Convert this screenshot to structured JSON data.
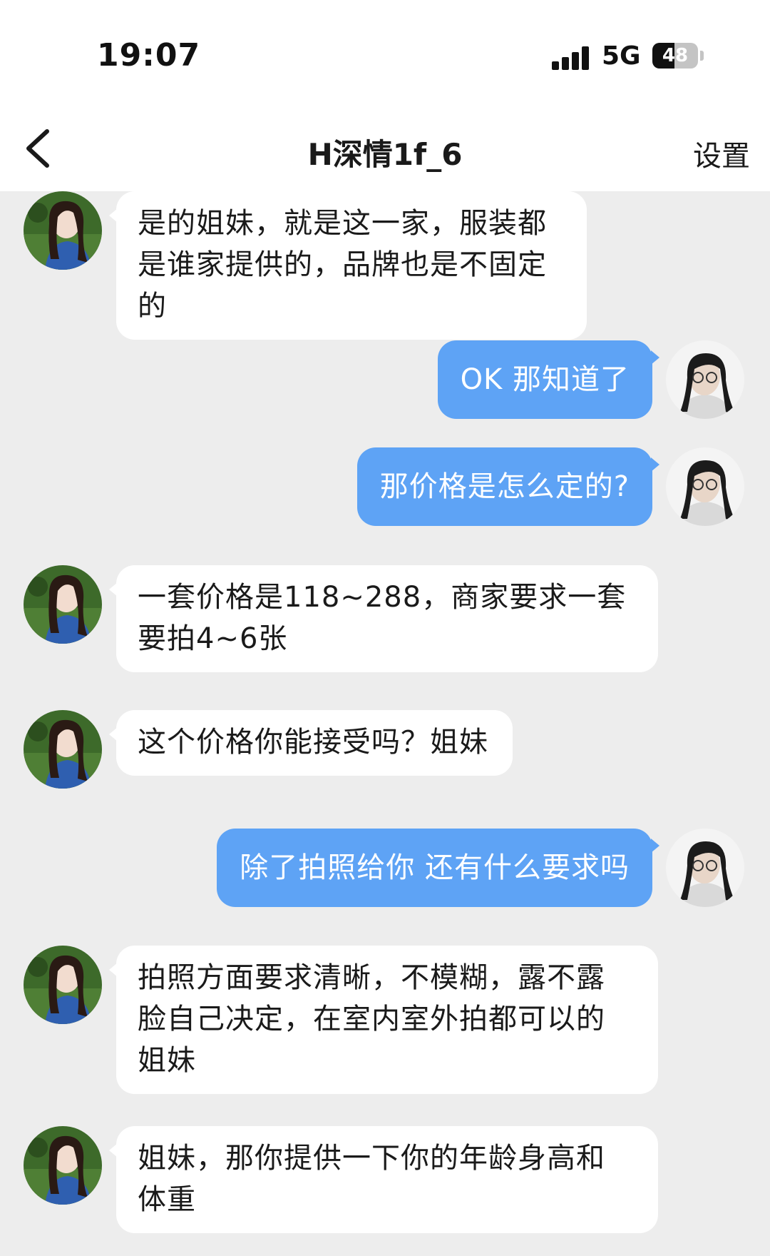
{
  "status_bar": {
    "time": "19:07",
    "network": "5G",
    "battery": "48",
    "battery_level": 0.48
  },
  "nav": {
    "back_icon": "chevron-left-icon",
    "title": "H深情1f_6",
    "settings_label": "设置"
  },
  "colors": {
    "background": "#ededed",
    "incoming_bubble": "#ffffff",
    "outgoing_bubble": "#5ea3f5"
  },
  "messages": [
    {
      "direction": "in",
      "text": "是的姐妹，就是这一家，服装都是谁家提供的，品牌也是不固定的"
    },
    {
      "direction": "out",
      "text": "OK 那知道了"
    },
    {
      "direction": "out",
      "text": "那价格是怎么定的?"
    },
    {
      "direction": "in",
      "text": "一套价格是118~288，商家要求一套要拍4~6张"
    },
    {
      "direction": "in",
      "text": "这个价格你能接受吗？姐妹"
    },
    {
      "direction": "out",
      "text": "除了拍照给你 还有什么要求吗"
    },
    {
      "direction": "in",
      "text": "拍照方面要求清晰，不模糊，露不露脸自己决定，在室内室外拍都可以的姐妹"
    },
    {
      "direction": "in",
      "text": "姐妹，那你提供一下你的年龄身高和体重"
    }
  ]
}
